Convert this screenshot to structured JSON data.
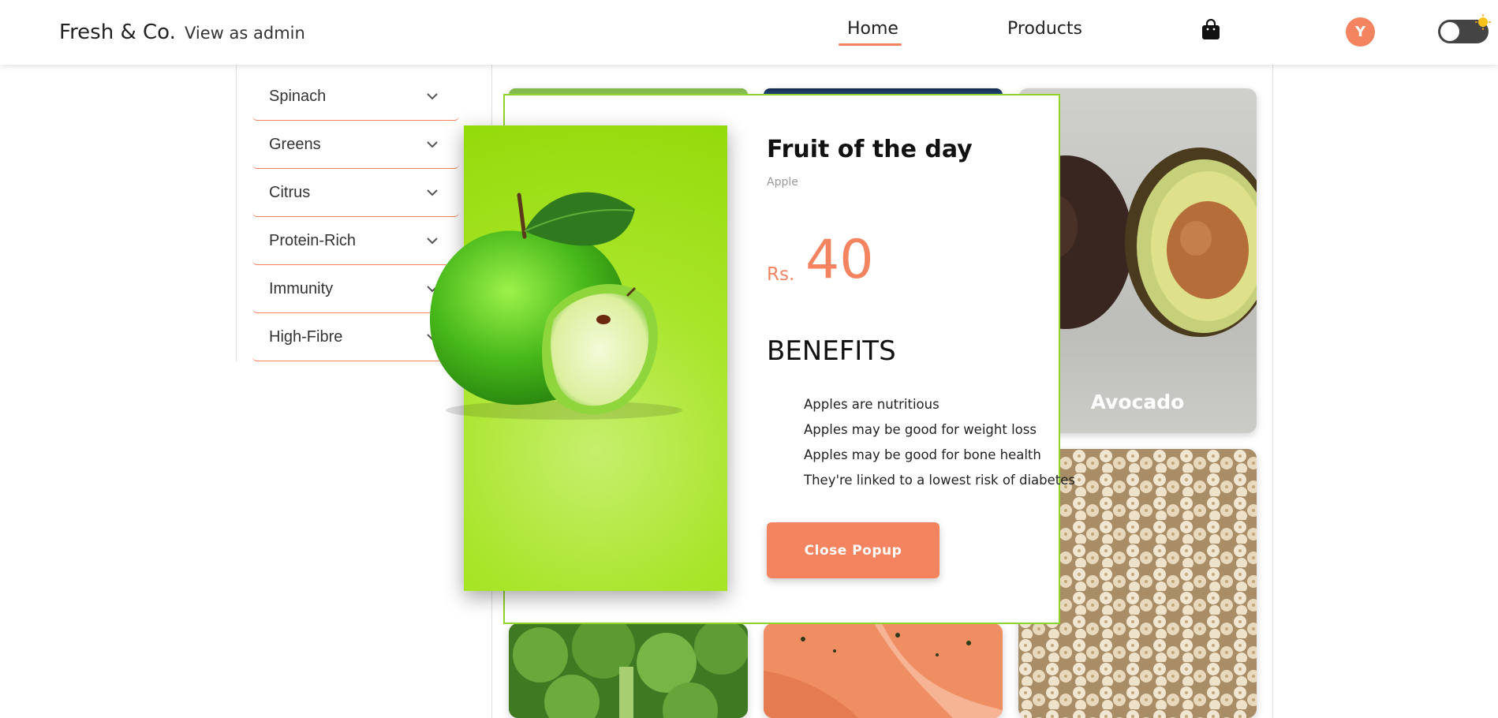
{
  "header": {
    "brand": "Fresh & Co.",
    "view_as_admin": "View as admin",
    "nav": {
      "home": "Home",
      "products": "Products"
    },
    "cart_icon": "shopping-bag-icon",
    "avatar_initial": "Y",
    "theme_toggle_icon": "sun-icon"
  },
  "sidebar": {
    "categories": [
      {
        "label": "Spinach"
      },
      {
        "label": "Greens"
      },
      {
        "label": "Citrus"
      },
      {
        "label": "Protein-Rich"
      },
      {
        "label": "Immunity"
      },
      {
        "label": "High-Fibre"
      }
    ]
  },
  "products": {
    "avocado": "Avocado"
  },
  "popup": {
    "title": "Fruit of the day",
    "fruit_name": "Apple",
    "price_prefix": "Rs.",
    "price": "40",
    "benefits_title": "BENEFITS",
    "benefits": [
      "Apples are nutritious",
      "Apples may be good for weight loss",
      "Apples may be good for bone health",
      "They're linked to a lowest risk of diabetes"
    ],
    "close_button": "Close Popup"
  },
  "colors": {
    "accent": "#f4845f",
    "popup_border": "#8fd42b",
    "popup_image_bg": "#a9e52a"
  }
}
